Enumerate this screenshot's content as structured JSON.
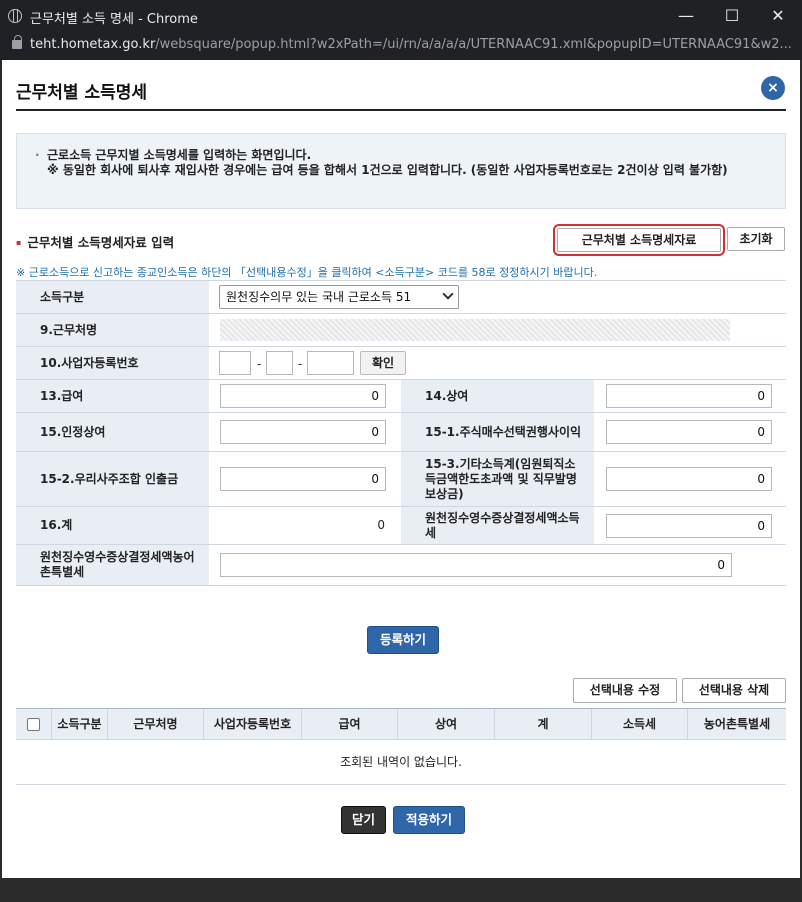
{
  "window": {
    "title": "근무처별 소득 명세 - Chrome"
  },
  "address": {
    "host": "teht.hometax.go.kr",
    "path": "/websquare/popup.html?w2xPath=/ui/rn/a/a/a/a/UTERNAAC91.xml&popupID=UTERNAAC91&w2..."
  },
  "popup": {
    "title": "근무처별 소득명세",
    "close_symbol": "×"
  },
  "info": {
    "line1": "근로소득 근무지별 소득명세를 입력하는 화면입니다.",
    "line2": "※ 동일한 회사에 퇴사후 재입사한 경우에는 급여 등을 합해서 1건으로 입력합니다. (동일한 사업자등록번호로는 2건이상 입력 불가함)"
  },
  "section": {
    "title": "근무처별 소득명세자료 입력",
    "fetch_button": "근무처별 소득명세자료",
    "reset_button": "초기화"
  },
  "notice": "※ 근로소득으로 신고하는 종교인소득은 하단의 「선택내용수정」을 클릭하여 <소득구분> 코드를 58로 정정하시기 바랍니다.",
  "form": {
    "income_type_label": "소득구분",
    "income_type_value": "원천징수의무 있는 국내 근로소득 51",
    "workplace_label": "9.근무처명",
    "bizno_label": "10.사업자등록번호",
    "confirm_button": "확인",
    "dash": "-",
    "salary_label": "13.급여",
    "salary_value": "0",
    "bonus_label": "14.상여",
    "bonus_value": "0",
    "recognized_bonus_label": "15.인정상여",
    "recognized_bonus_value": "0",
    "stock_option_label": "15-1.주식매수선택권행사이익",
    "stock_option_value": "0",
    "esop_label": "15-2.우리사주조합 인출금",
    "esop_value": "0",
    "other_label": "15-3.기타소득계(임원퇴직소득금액한도초과액 및 직무발명보상금)",
    "other_value": "0",
    "total_label": "16.계",
    "total_value": "0",
    "tax_label": "원천징수영수증상결정세액소득세",
    "tax_value": "0",
    "rural_tax_label": "원천징수영수증상결정세액농어촌특별세",
    "rural_tax_value": "0"
  },
  "register_button": "등록하기",
  "grid": {
    "edit_button": "선택내용 수정",
    "delete_button": "선택내용 삭제",
    "columns": [
      "소득구분",
      "근무처명",
      "사업자등록번호",
      "급여",
      "상여",
      "계",
      "소득세",
      "농어촌특별세"
    ],
    "empty_text": "조회된 내역이 없습니다."
  },
  "footer": {
    "close_button": "닫기",
    "apply_button": "적용하기"
  }
}
